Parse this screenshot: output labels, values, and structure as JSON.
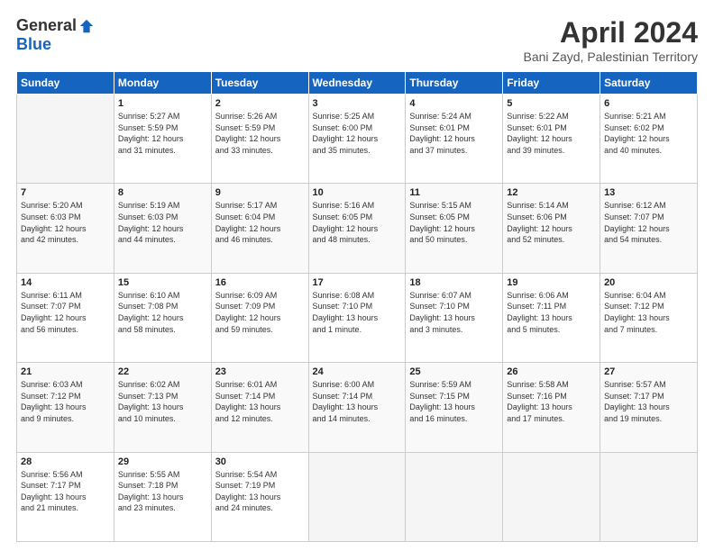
{
  "header": {
    "logo_general": "General",
    "logo_blue": "Blue",
    "title": "April 2024",
    "location": "Bani Zayd, Palestinian Territory"
  },
  "days_header": [
    "Sunday",
    "Monday",
    "Tuesday",
    "Wednesday",
    "Thursday",
    "Friday",
    "Saturday"
  ],
  "weeks": [
    [
      {
        "day": "",
        "content": ""
      },
      {
        "day": "1",
        "content": "Sunrise: 5:27 AM\nSunset: 5:59 PM\nDaylight: 12 hours\nand 31 minutes."
      },
      {
        "day": "2",
        "content": "Sunrise: 5:26 AM\nSunset: 5:59 PM\nDaylight: 12 hours\nand 33 minutes."
      },
      {
        "day": "3",
        "content": "Sunrise: 5:25 AM\nSunset: 6:00 PM\nDaylight: 12 hours\nand 35 minutes."
      },
      {
        "day": "4",
        "content": "Sunrise: 5:24 AM\nSunset: 6:01 PM\nDaylight: 12 hours\nand 37 minutes."
      },
      {
        "day": "5",
        "content": "Sunrise: 5:22 AM\nSunset: 6:01 PM\nDaylight: 12 hours\nand 39 minutes."
      },
      {
        "day": "6",
        "content": "Sunrise: 5:21 AM\nSunset: 6:02 PM\nDaylight: 12 hours\nand 40 minutes."
      }
    ],
    [
      {
        "day": "7",
        "content": "Sunrise: 5:20 AM\nSunset: 6:03 PM\nDaylight: 12 hours\nand 42 minutes."
      },
      {
        "day": "8",
        "content": "Sunrise: 5:19 AM\nSunset: 6:03 PM\nDaylight: 12 hours\nand 44 minutes."
      },
      {
        "day": "9",
        "content": "Sunrise: 5:17 AM\nSunset: 6:04 PM\nDaylight: 12 hours\nand 46 minutes."
      },
      {
        "day": "10",
        "content": "Sunrise: 5:16 AM\nSunset: 6:05 PM\nDaylight: 12 hours\nand 48 minutes."
      },
      {
        "day": "11",
        "content": "Sunrise: 5:15 AM\nSunset: 6:05 PM\nDaylight: 12 hours\nand 50 minutes."
      },
      {
        "day": "12",
        "content": "Sunrise: 5:14 AM\nSunset: 6:06 PM\nDaylight: 12 hours\nand 52 minutes."
      },
      {
        "day": "13",
        "content": "Sunrise: 6:12 AM\nSunset: 7:07 PM\nDaylight: 12 hours\nand 54 minutes."
      }
    ],
    [
      {
        "day": "14",
        "content": "Sunrise: 6:11 AM\nSunset: 7:07 PM\nDaylight: 12 hours\nand 56 minutes."
      },
      {
        "day": "15",
        "content": "Sunrise: 6:10 AM\nSunset: 7:08 PM\nDaylight: 12 hours\nand 58 minutes."
      },
      {
        "day": "16",
        "content": "Sunrise: 6:09 AM\nSunset: 7:09 PM\nDaylight: 12 hours\nand 59 minutes."
      },
      {
        "day": "17",
        "content": "Sunrise: 6:08 AM\nSunset: 7:10 PM\nDaylight: 13 hours\nand 1 minute."
      },
      {
        "day": "18",
        "content": "Sunrise: 6:07 AM\nSunset: 7:10 PM\nDaylight: 13 hours\nand 3 minutes."
      },
      {
        "day": "19",
        "content": "Sunrise: 6:06 AM\nSunset: 7:11 PM\nDaylight: 13 hours\nand 5 minutes."
      },
      {
        "day": "20",
        "content": "Sunrise: 6:04 AM\nSunset: 7:12 PM\nDaylight: 13 hours\nand 7 minutes."
      }
    ],
    [
      {
        "day": "21",
        "content": "Sunrise: 6:03 AM\nSunset: 7:12 PM\nDaylight: 13 hours\nand 9 minutes."
      },
      {
        "day": "22",
        "content": "Sunrise: 6:02 AM\nSunset: 7:13 PM\nDaylight: 13 hours\nand 10 minutes."
      },
      {
        "day": "23",
        "content": "Sunrise: 6:01 AM\nSunset: 7:14 PM\nDaylight: 13 hours\nand 12 minutes."
      },
      {
        "day": "24",
        "content": "Sunrise: 6:00 AM\nSunset: 7:14 PM\nDaylight: 13 hours\nand 14 minutes."
      },
      {
        "day": "25",
        "content": "Sunrise: 5:59 AM\nSunset: 7:15 PM\nDaylight: 13 hours\nand 16 minutes."
      },
      {
        "day": "26",
        "content": "Sunrise: 5:58 AM\nSunset: 7:16 PM\nDaylight: 13 hours\nand 17 minutes."
      },
      {
        "day": "27",
        "content": "Sunrise: 5:57 AM\nSunset: 7:17 PM\nDaylight: 13 hours\nand 19 minutes."
      }
    ],
    [
      {
        "day": "28",
        "content": "Sunrise: 5:56 AM\nSunset: 7:17 PM\nDaylight: 13 hours\nand 21 minutes."
      },
      {
        "day": "29",
        "content": "Sunrise: 5:55 AM\nSunset: 7:18 PM\nDaylight: 13 hours\nand 23 minutes."
      },
      {
        "day": "30",
        "content": "Sunrise: 5:54 AM\nSunset: 7:19 PM\nDaylight: 13 hours\nand 24 minutes."
      },
      {
        "day": "",
        "content": ""
      },
      {
        "day": "",
        "content": ""
      },
      {
        "day": "",
        "content": ""
      },
      {
        "day": "",
        "content": ""
      }
    ]
  ]
}
